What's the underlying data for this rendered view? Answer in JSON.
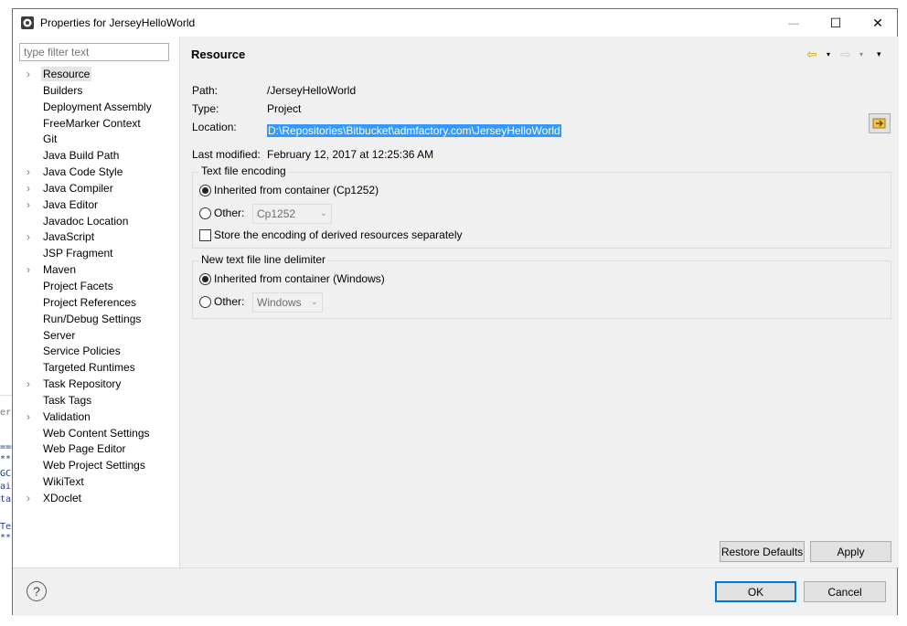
{
  "window": {
    "title": "Properties for JerseyHelloWorld",
    "minimize_glyph": "—",
    "maximize_glyph": "☐",
    "close_glyph": "✕"
  },
  "background": {
    "fragments": [
      "ers",
      "===",
      "***",
      "GC",
      "air",
      "tal",
      "  F",
      "Te",
      "***"
    ]
  },
  "sidebar": {
    "filter_placeholder": "type filter text",
    "items": [
      {
        "label": "Resource",
        "expandable": true,
        "selected": true
      },
      {
        "label": "Builders",
        "expandable": false
      },
      {
        "label": "Deployment Assembly",
        "expandable": false
      },
      {
        "label": "FreeMarker Context",
        "expandable": false
      },
      {
        "label": "Git",
        "expandable": false
      },
      {
        "label": "Java Build Path",
        "expandable": false
      },
      {
        "label": "Java Code Style",
        "expandable": true
      },
      {
        "label": "Java Compiler",
        "expandable": true
      },
      {
        "label": "Java Editor",
        "expandable": true
      },
      {
        "label": "Javadoc Location",
        "expandable": false
      },
      {
        "label": "JavaScript",
        "expandable": true
      },
      {
        "label": "JSP Fragment",
        "expandable": false
      },
      {
        "label": "Maven",
        "expandable": true
      },
      {
        "label": "Project Facets",
        "expandable": false
      },
      {
        "label": "Project References",
        "expandable": false
      },
      {
        "label": "Run/Debug Settings",
        "expandable": false
      },
      {
        "label": "Server",
        "expandable": false
      },
      {
        "label": "Service Policies",
        "expandable": false
      },
      {
        "label": "Targeted Runtimes",
        "expandable": false
      },
      {
        "label": "Task Repository",
        "expandable": true
      },
      {
        "label": "Task Tags",
        "expandable": false
      },
      {
        "label": "Validation",
        "expandable": true
      },
      {
        "label": "Web Content Settings",
        "expandable": false
      },
      {
        "label": "Web Page Editor",
        "expandable": false
      },
      {
        "label": "Web Project Settings",
        "expandable": false
      },
      {
        "label": "WikiText",
        "expandable": false
      },
      {
        "label": "XDoclet",
        "expandable": true
      }
    ]
  },
  "main": {
    "title": "Resource",
    "nav": {
      "back": "⇦",
      "forward": "⇨",
      "dropdown": "▾"
    },
    "path_label": "Path:",
    "path_value": "/JerseyHelloWorld",
    "type_label": "Type:",
    "type_value": "Project",
    "location_label": "Location:",
    "location_value": "D:\\Repositories\\Bitbucket\\admfactory.com\\JerseyHelloWorld",
    "modified_label": "Last modified:",
    "modified_value": "February 12, 2017 at 12:25:36 AM",
    "encoding": {
      "title": "Text file encoding",
      "inherited_label": "Inherited from container (Cp1252)",
      "inherited_selected": true,
      "other_label": "Other:",
      "other_value": "Cp1252",
      "store_label": "Store the encoding of derived resources separately",
      "store_checked": false
    },
    "delimiter": {
      "title": "New text file line delimiter",
      "inherited_label": "Inherited from container (Windows)",
      "inherited_selected": true,
      "other_label": "Other:",
      "other_value": "Windows"
    },
    "restore_defaults": "Restore Defaults",
    "apply": "Apply"
  },
  "footer": {
    "help_glyph": "?",
    "ok": "OK",
    "cancel": "Cancel"
  },
  "colors": {
    "accent": "#0078d7",
    "selection": "#3399ff",
    "dialog_bg": "#f0f0f0",
    "window_border": "#2b79d0"
  }
}
